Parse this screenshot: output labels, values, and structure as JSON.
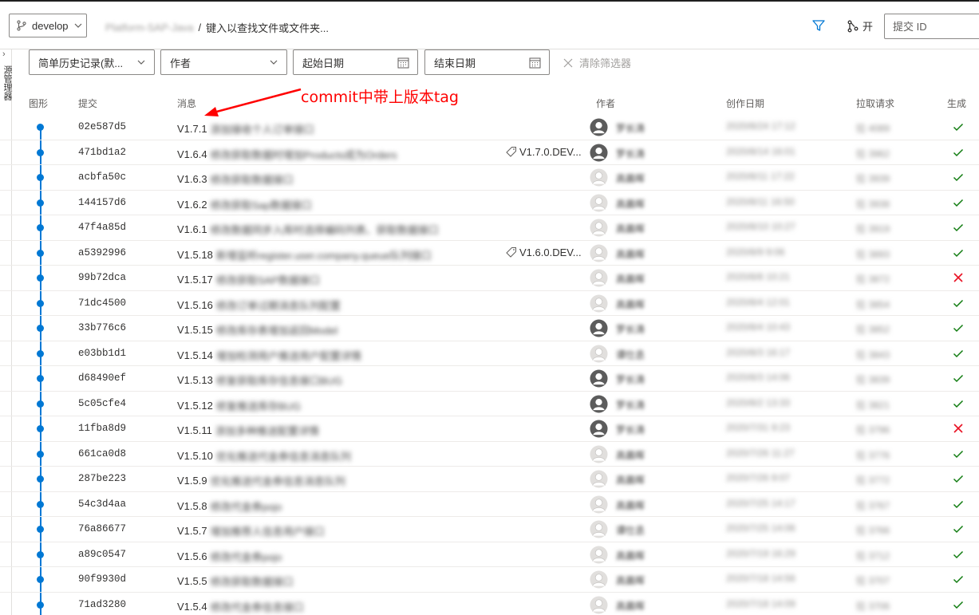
{
  "topbar": {
    "branch": "develop",
    "repo_path": "Platform-SAP-Java",
    "separator": "/",
    "search_prompt": "键入以查找文件或文件夹...",
    "open_label": "开",
    "commit_id_placeholder": "提交 ID"
  },
  "left_rail": {
    "arrow": "›",
    "label": "源管理器"
  },
  "filters": {
    "history": "简单历史记录(默...",
    "author": "作者",
    "start_date": "起始日期",
    "end_date": "结束日期",
    "clear": "清除筛选器"
  },
  "columns": {
    "graph": "图形",
    "commit": "提交",
    "message": "消息",
    "author": "作者",
    "date": "创作日期",
    "pr": "拉取请求",
    "build": "生成"
  },
  "annotation": {
    "text": "commit中带上版本tag"
  },
  "colors": {
    "accent": "#0078d4",
    "success": "#107c10",
    "failure": "#e81123",
    "annotation": "#ff0000"
  },
  "commits": [
    {
      "hash": "02e587d5",
      "version": "V1.7.1",
      "desc": "添加接收个人订单接口",
      "tag": "",
      "avatar": "dark",
      "author": "罗长涛",
      "date": "2020/8/24 17:12",
      "pr": "拉 4089",
      "status": "success"
    },
    {
      "hash": "471bd1a2",
      "version": "V1.6.4",
      "desc": "修改获取数据时增加Products成为Orders",
      "tag": "V1.7.0.DEV...",
      "avatar": "dark",
      "author": "罗长涛",
      "date": "2020/8/14 16:01",
      "pr": "拉 3962",
      "status": "success"
    },
    {
      "hash": "acbfa50c",
      "version": "V1.6.3",
      "desc": "修改获取数据接口",
      "tag": "",
      "avatar": "light",
      "author": "高晨晖",
      "date": "2020/8/11 17:22",
      "pr": "拉 3939",
      "status": "success"
    },
    {
      "hash": "144157d6",
      "version": "V1.6.2",
      "desc": "修改获取Sap数据接口",
      "tag": "",
      "avatar": "light",
      "author": "高晨晖",
      "date": "2020/8/11 16:50",
      "pr": "拉 3938",
      "status": "success"
    },
    {
      "hash": "47f4a85d",
      "version": "V1.6.1",
      "desc": "修改数据同步入库时选择编码列表、获取数据接口",
      "tag": "",
      "avatar": "light",
      "author": "高晨晖",
      "date": "2020/8/10 10:27",
      "pr": "拉 3919",
      "status": "success"
    },
    {
      "hash": "a5392996",
      "version": "V1.5.18",
      "desc": "新增监听register.user.company.queue队列接口",
      "tag": "V1.6.0.DEV...",
      "avatar": "light",
      "author": "高晨晖",
      "date": "2020/8/9 9:06",
      "pr": "拉 3893",
      "status": "success"
    },
    {
      "hash": "99b72dca",
      "version": "V1.5.17",
      "desc": "修改获取SAP数据接口",
      "tag": "",
      "avatar": "light",
      "author": "高晨晖",
      "date": "2020/8/8 10:21",
      "pr": "拉 3872",
      "status": "failure"
    },
    {
      "hash": "71dc4500",
      "version": "V1.5.16",
      "desc": "修改订单过期消息队列配置",
      "tag": "",
      "avatar": "light",
      "author": "高晨晖",
      "date": "2020/8/4 12:01",
      "pr": "拉 3854",
      "status": "success"
    },
    {
      "hash": "33b776c6",
      "version": "V1.5.15",
      "desc": "修改库存表增加返回Model",
      "tag": "",
      "avatar": "dark",
      "author": "罗长涛",
      "date": "2020/8/4 10:43",
      "pr": "拉 3852",
      "status": "success"
    },
    {
      "hash": "e03bb1d1",
      "version": "V1.5.14",
      "desc": "增加检测用户推送用户配置详情",
      "tag": "",
      "avatar": "light",
      "author": "谭仕丞",
      "date": "2020/8/3 16:17",
      "pr": "拉 3843",
      "status": "success"
    },
    {
      "hash": "d68490ef",
      "version": "V1.5.13",
      "desc": "修复获取库存信息接口BUG",
      "tag": "",
      "avatar": "dark",
      "author": "罗长涛",
      "date": "2020/8/3 14:06",
      "pr": "拉 3839",
      "status": "success"
    },
    {
      "hash": "5c05cfe4",
      "version": "V1.5.12",
      "desc": "修复推送库存BUG",
      "tag": "",
      "avatar": "dark",
      "author": "罗长涛",
      "date": "2020/8/2 13:33",
      "pr": "拉 3821",
      "status": "success"
    },
    {
      "hash": "11fba8d9",
      "version": "V1.5.11",
      "desc": "添加多种推送配置详情",
      "tag": "",
      "avatar": "dark",
      "author": "罗长涛",
      "date": "2020/7/31 9:23",
      "pr": "拉 3796",
      "status": "failure"
    },
    {
      "hash": "661ca0d8",
      "version": "V1.5.10",
      "desc": "优化推送代金券信息消息队列",
      "tag": "",
      "avatar": "light",
      "author": "高晨晖",
      "date": "2020/7/26 11:27",
      "pr": "拉 3776",
      "status": "success"
    },
    {
      "hash": "287be223",
      "version": "V1.5.9",
      "desc": "优化推送代金券信息消息队列",
      "tag": "",
      "avatar": "light",
      "author": "高晨晖",
      "date": "2020/7/26 9:07",
      "pr": "拉 3772",
      "status": "success"
    },
    {
      "hash": "54c3d4aa",
      "version": "V1.5.8",
      "desc": "修改代金券pojo",
      "tag": "",
      "avatar": "light",
      "author": "高晨晖",
      "date": "2020/7/25 14:17",
      "pr": "拉 3767",
      "status": "success"
    },
    {
      "hash": "76a86677",
      "version": "V1.5.7",
      "desc": "增加推荐人信息用户接口",
      "tag": "",
      "avatar": "light",
      "author": "谭仕丞",
      "date": "2020/7/25 14:06",
      "pr": "拉 3766",
      "status": "success"
    },
    {
      "hash": "a89c0547",
      "version": "V1.5.6",
      "desc": "修改代金券pojo",
      "tag": "",
      "avatar": "light",
      "author": "高晨晖",
      "date": "2020/7/19 16:29",
      "pr": "拉 3712",
      "status": "success"
    },
    {
      "hash": "90f9930d",
      "version": "V1.5.5",
      "desc": "修改获取数据接口",
      "tag": "",
      "avatar": "light",
      "author": "高晨晖",
      "date": "2020/7/18 14:56",
      "pr": "拉 3707",
      "status": "success"
    },
    {
      "hash": "71ad3280",
      "version": "V1.5.4",
      "desc": "修改代金券信息接口",
      "tag": "",
      "avatar": "light",
      "author": "高晨晖",
      "date": "2020/7/18 14:09",
      "pr": "拉 3706",
      "status": "success"
    }
  ]
}
